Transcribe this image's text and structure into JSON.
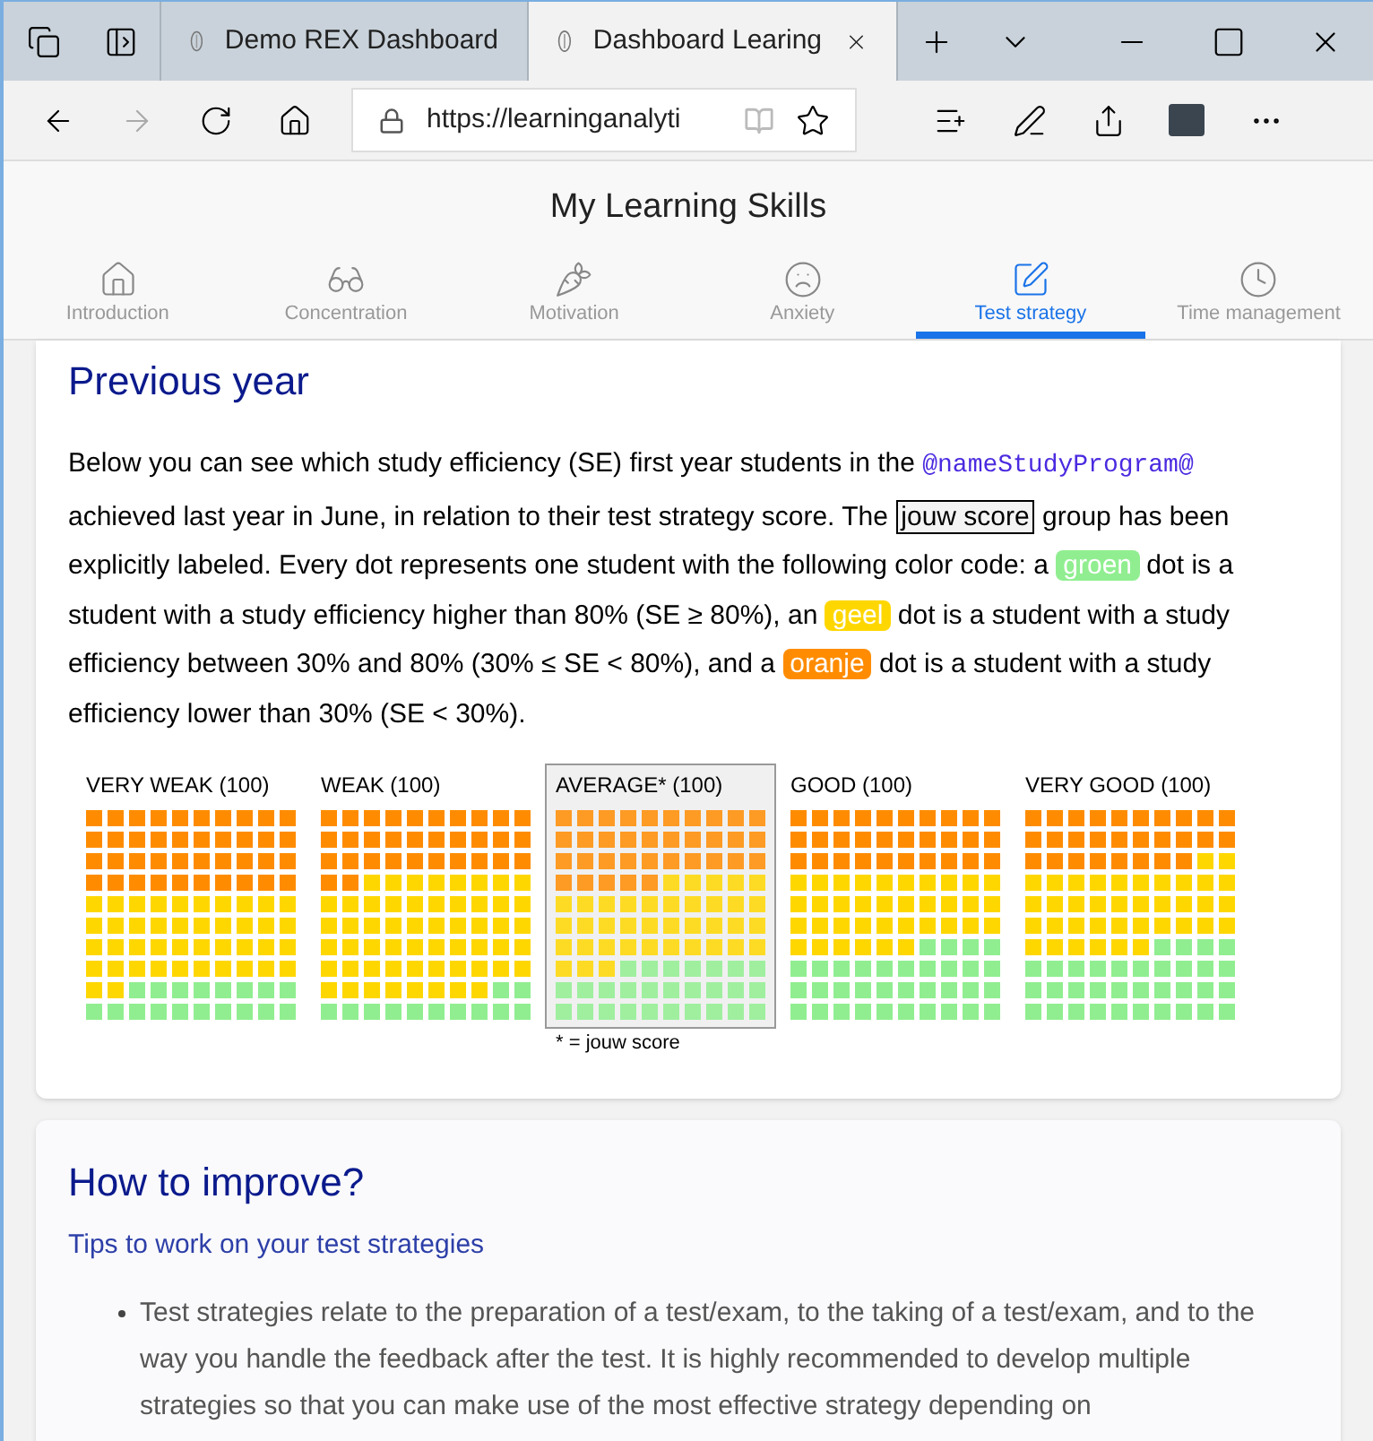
{
  "browser": {
    "tabs": [
      {
        "title": "Demo REX Dashboard",
        "selected": false
      },
      {
        "title": "Dashboard Learing",
        "selected": true
      }
    ],
    "url": "https://learninganalyti"
  },
  "page": {
    "title": "My Learning Skills",
    "nav": [
      {
        "label": "Introduction",
        "selected": false
      },
      {
        "label": "Concentration",
        "selected": false
      },
      {
        "label": "Motivation",
        "selected": false
      },
      {
        "label": "Anxiety",
        "selected": false
      },
      {
        "label": "Test strategy",
        "selected": true
      },
      {
        "label": "Time management",
        "selected": false
      }
    ]
  },
  "previous_year": {
    "heading": "Previous year",
    "paragraph": [
      {
        "kind": "text",
        "text": "Below you can see which study efficiency (SE) first year students in the "
      },
      {
        "kind": "code",
        "text": "@nameStudyProgram@"
      },
      {
        "kind": "text",
        "text": " achieved last year in June, in relation to their test strategy score. The "
      },
      {
        "kind": "boxed",
        "text": "jouw score"
      },
      {
        "kind": "text",
        "text": " group has been explicitly labeled. Every dot represents one student with the following color code: a "
      },
      {
        "kind": "badge",
        "text": "groen",
        "color": "#90ee90"
      },
      {
        "kind": "text",
        "text": " dot is a student with a study efficiency higher than 80% (SE ≥ 80%), an "
      },
      {
        "kind": "badge",
        "text": "geel",
        "color": "#ffd700"
      },
      {
        "kind": "text",
        "text": " dot is a student with a study efficiency between 30% and 80% (30% ≤ SE < 80%), and a "
      },
      {
        "kind": "badge",
        "text": "oranje",
        "color": "#ff8c00"
      },
      {
        "kind": "text",
        "text": " dot is a student with a study efficiency lower than 30% (SE < 30%)."
      }
    ],
    "groups": [
      {
        "label": "VERY WEAK (100)",
        "selected": false
      },
      {
        "label": "WEAK (100)",
        "selected": false
      },
      {
        "label": "AVERAGE* (100)",
        "selected": true
      },
      {
        "label": "GOOD (100)",
        "selected": false
      },
      {
        "label": "VERY GOOD (100)",
        "selected": false
      }
    ],
    "footnote": "* = jouw score"
  },
  "improve": {
    "heading": "How to improve?",
    "subheading": "Tips to work on your test strategies",
    "bullets": [
      "Test strategies relate to the preparation of a test/exam, to the taking of a test/exam, and to the way you handle the feedback after the test. It is highly recommended to develop multiple strategies so that you can make use of the most effective strategy depending on"
    ]
  }
}
